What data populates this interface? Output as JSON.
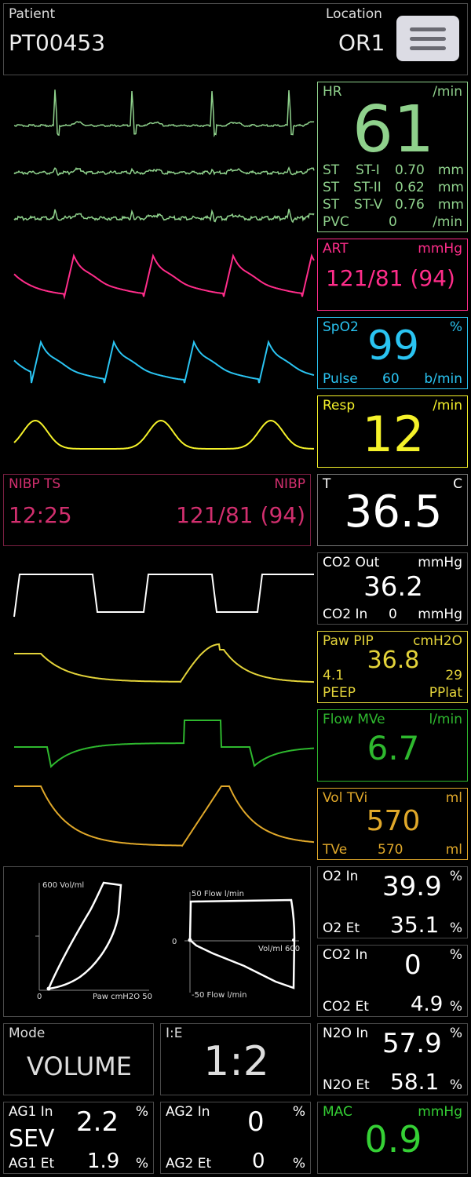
{
  "header": {
    "patient_label": "Patient",
    "patient_id": "PT00453",
    "location_label": "Location",
    "location_value": "OR1",
    "menu_icon": "hamburger-menu-icon"
  },
  "colors": {
    "ecg": "#8fd18c",
    "art": "#ff2d8a",
    "spo2": "#2ac4f2",
    "resp": "#f5f22a",
    "nibp": "#d12f6e",
    "co2": "#ffffff",
    "paw": "#e3d33a",
    "flow": "#2eb82e",
    "vol": "#e0a82a",
    "gas_mac": "#35d035"
  },
  "hr": {
    "label": "HR",
    "unit": "/min",
    "value": "61",
    "st_rows": [
      {
        "tag": "ST",
        "name": "ST-I",
        "value": "0.70",
        "unit": "mm"
      },
      {
        "tag": "ST",
        "name": "ST-II",
        "value": "0.62",
        "unit": "mm"
      },
      {
        "tag": "ST",
        "name": "ST-V",
        "value": "0.76",
        "unit": "mm"
      }
    ],
    "pvc_label": "PVC",
    "pvc_value": "0",
    "pvc_unit": "/min"
  },
  "art": {
    "label": "ART",
    "unit": "mmHg",
    "value": "121/81 (94)"
  },
  "spo2": {
    "label": "SpO2",
    "unit": "%",
    "value": "99",
    "pulse_label": "Pulse",
    "pulse_value": "60",
    "pulse_unit": "b/min"
  },
  "resp": {
    "label": "Resp",
    "unit": "/min",
    "value": "12"
  },
  "nibp": {
    "ts_label": "NIBP TS",
    "label": "NIBP",
    "time": "12:25",
    "value": "121/81 (94)"
  },
  "temp": {
    "label": "T",
    "unit": "C",
    "value": "36.5"
  },
  "co2": {
    "label": "CO2 Out",
    "unit": "mmHg",
    "value": "36.2",
    "in_label": "CO2 In",
    "in_value": "0",
    "in_unit": "mmHg"
  },
  "paw": {
    "label": "Paw PIP",
    "unit": "cmH2O",
    "value": "36.8",
    "peep_value": "4.1",
    "pplat_value": "29",
    "peep_label": "PEEP",
    "pplat_label": "PPlat"
  },
  "flow": {
    "label": "Flow MVe",
    "unit": "l/min",
    "value": "6.7"
  },
  "vol": {
    "label": "Vol TVi",
    "unit": "ml",
    "value": "570",
    "tve_label": "TVe",
    "tve_value": "570",
    "tve_unit": "ml"
  },
  "loops": {
    "pv_ymax": "600 Vol/ml",
    "pv_xlabel": "Paw cmH2O 50",
    "pv_zero": "0",
    "fv_ymax": "50 Flow l/min",
    "fv_ymin": "-50 Flow l/min",
    "fv_xlabel": "Vol/ml 600",
    "fv_zero": "0"
  },
  "o2": {
    "in_label": "O2 In",
    "in_value": "39.9",
    "et_label": "O2 Et",
    "et_value": "35.1",
    "unit": "%"
  },
  "co2gas": {
    "in_label": "CO2 In",
    "in_value": "0",
    "et_label": "CO2 Et",
    "et_value": "4.9",
    "unit": "%"
  },
  "n2o": {
    "in_label": "N2O In",
    "in_value": "57.9",
    "et_label": "N2O Et",
    "et_value": "58.1",
    "unit": "%"
  },
  "mode": {
    "label": "Mode",
    "value": "VOLUME"
  },
  "ie": {
    "label": "I:E",
    "value": "1:2"
  },
  "ag1": {
    "in_label": "AG1 In",
    "in_value": "2.2",
    "agent": "SEV",
    "et_label": "AG1 Et",
    "et_value": "1.9",
    "unit": "%"
  },
  "ag2": {
    "in_label": "AG2 In",
    "in_value": "0",
    "et_label": "AG2 Et",
    "et_value": "0",
    "unit": "%"
  },
  "mac": {
    "label": "MAC",
    "unit": "mmHg",
    "value": "0.9"
  }
}
